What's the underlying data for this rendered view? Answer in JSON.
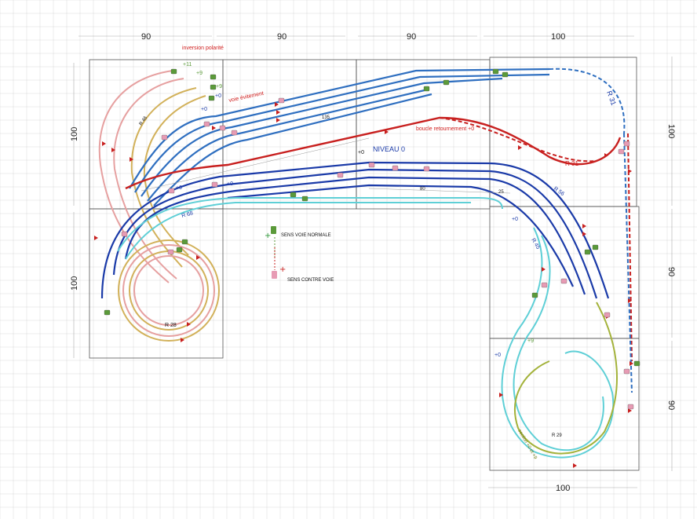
{
  "dimensions": {
    "top": [
      "90",
      "90",
      "90",
      "100"
    ],
    "bottom": "100",
    "left_upper": "100",
    "left_lower": "100",
    "right_upper": "100",
    "right_mid": "90",
    "right_lower": "90"
  },
  "labels": {
    "inversion": "inversion polarité",
    "voie_evitement": "voie évitement",
    "boucle": "boucle retournement +0",
    "niveau": "NIVEAU 0",
    "len_135": "135",
    "len_80": "80",
    "len_25": "25",
    "r46": "R 46",
    "r31_top": "R 31",
    "r31_mid": "R 31",
    "r68": "R 68",
    "r56": "R 56",
    "r45": "R 45",
    "r28": "R 28",
    "r29": "R 29",
    "section": "section +0 et +9",
    "lvl_p11": "+11",
    "lvl_p9a": "+9",
    "lvl_p9b": "+9",
    "lvl_p9c": "+9",
    "lvl_p0a": "+0",
    "lvl_p0b": "+0",
    "lvl_p0c": "+0",
    "lvl_p0d": "+0",
    "lvl_p0e": "+0",
    "lvl_p0f": "+0",
    "lvl_p0g": "+0"
  },
  "legend": {
    "normal": "SENS VOIE NORMALE",
    "contre": "SENS CONTRE VOIE"
  },
  "colors": {
    "grid": "#d9d9d9",
    "board": "#555555",
    "red": "#c8201f",
    "blue_dark": "#1a3aa8",
    "blue_mid": "#2f6fc0",
    "cyan": "#5ecfd6",
    "pink": "#e6a0a0",
    "ochre": "#d2b15a",
    "olive": "#a3b23a",
    "train_green": "#5b9a3a",
    "train_pink": "#e79bb4"
  }
}
